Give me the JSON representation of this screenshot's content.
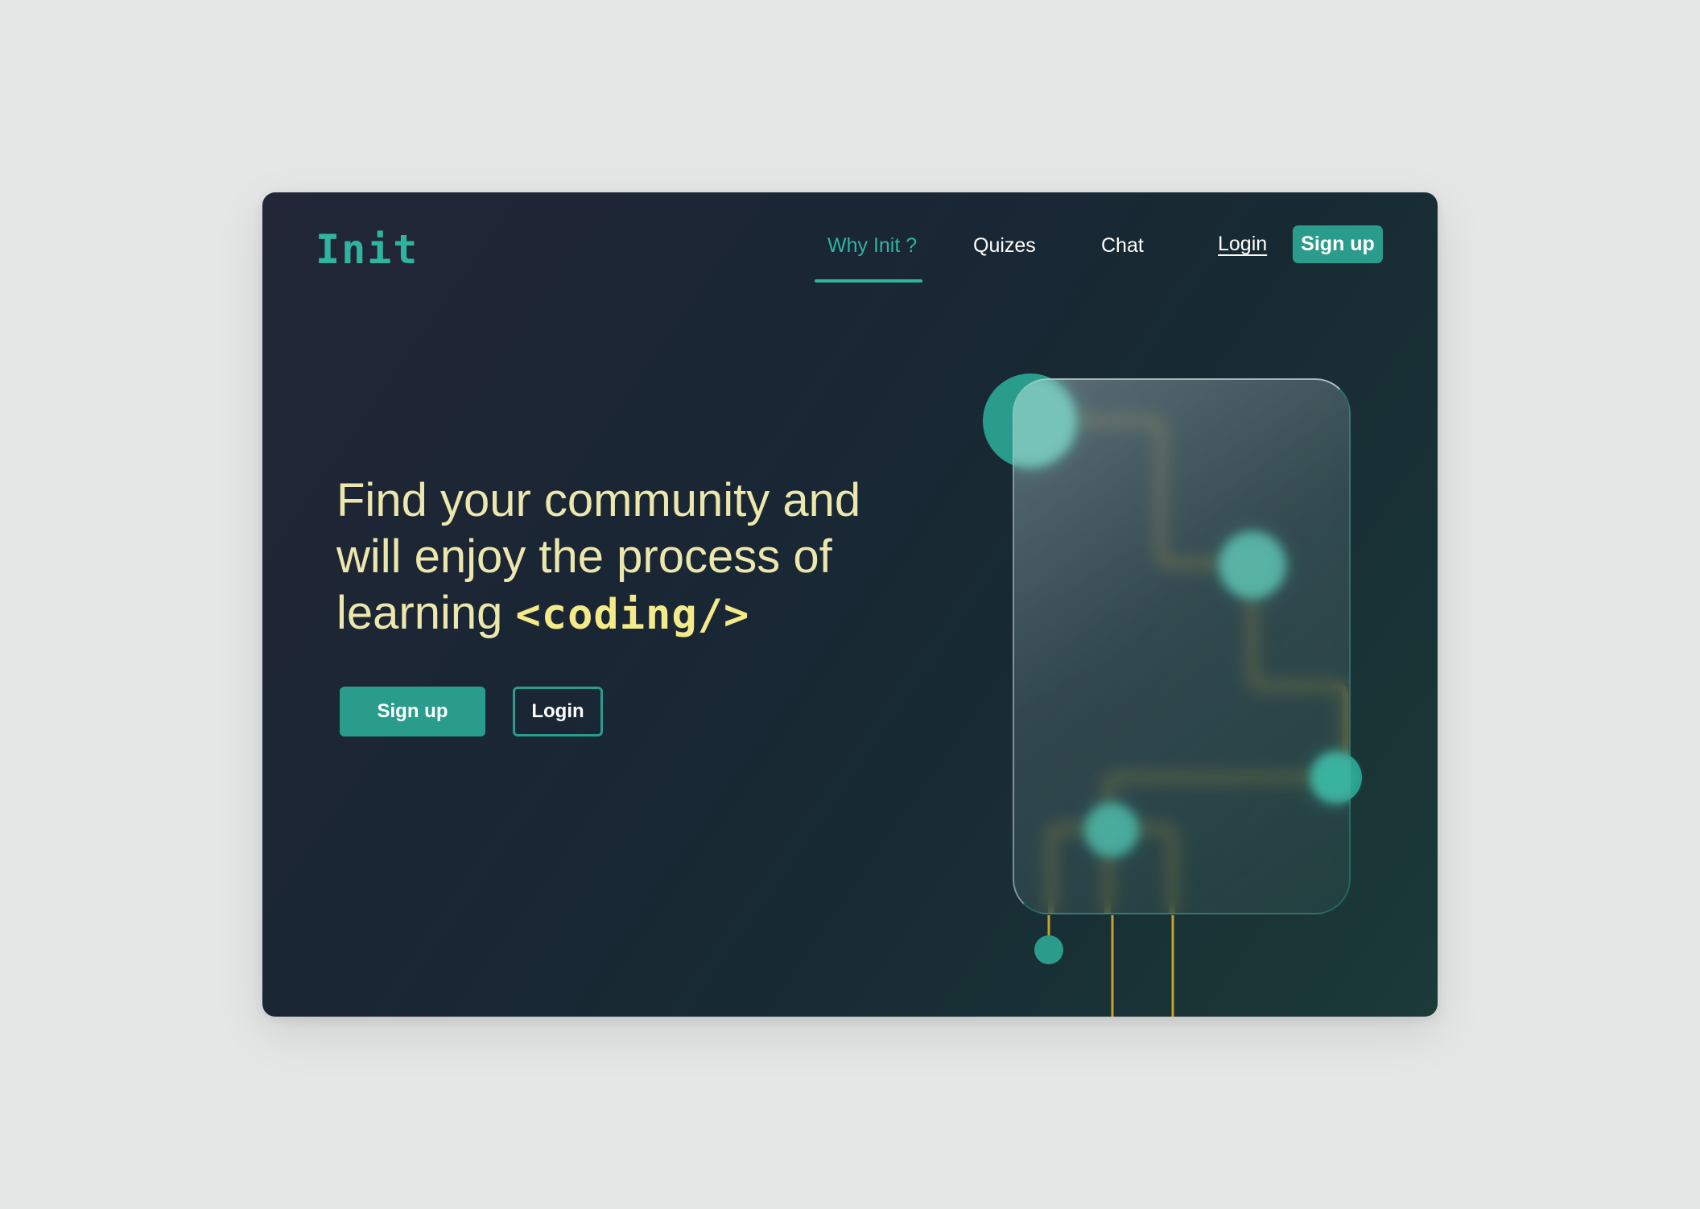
{
  "brand": {
    "logo_text": "Init"
  },
  "nav": {
    "links": [
      {
        "label": "Why Init ?",
        "active": true
      },
      {
        "label": "Quizes",
        "active": false
      },
      {
        "label": "Chat",
        "active": false
      }
    ],
    "login_label": "Login",
    "signup_label": "Sign up"
  },
  "hero": {
    "headline_line1": "Find your community and",
    "headline_line2": "will enjoy the process of",
    "headline_line3": "learning",
    "code_word": "<coding/>",
    "signup_label": "Sign up",
    "login_label": "Login"
  },
  "colors": {
    "accent": "#2a9c8c",
    "headline": "#ece7ac",
    "code_word": "#f4ea8a",
    "circuit": "#c9a22a",
    "background": "#1a2634"
  },
  "illustration": {
    "icon": "circuit-glass-card-illustration"
  }
}
